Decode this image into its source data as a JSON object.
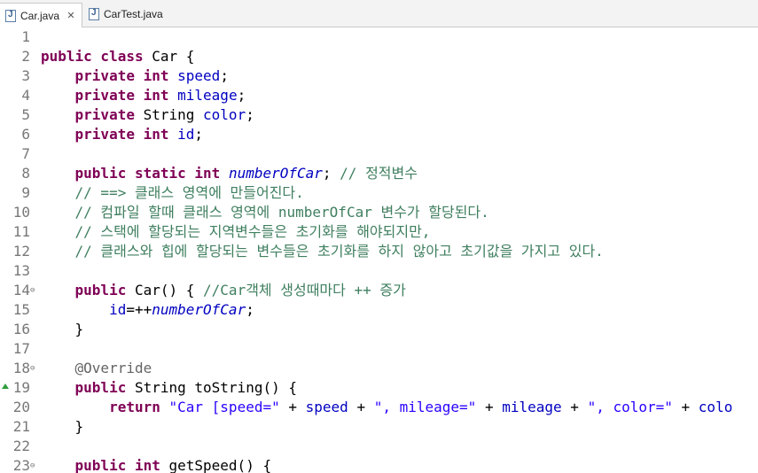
{
  "tabs": [
    {
      "label": "Car.java",
      "active": true
    },
    {
      "label": "CarTest.java",
      "active": false
    }
  ],
  "close_glyph": "✕",
  "lines": [
    {
      "n": "1",
      "tokens": []
    },
    {
      "n": "2",
      "tokens": [
        {
          "t": "public class",
          "c": "kw"
        },
        {
          "t": " Car {",
          "c": ""
        }
      ]
    },
    {
      "n": "3",
      "tokens": [
        {
          "t": "    ",
          "c": ""
        },
        {
          "t": "private int",
          "c": "kw"
        },
        {
          "t": " ",
          "c": ""
        },
        {
          "t": "speed",
          "c": "fld"
        },
        {
          "t": ";",
          "c": ""
        }
      ]
    },
    {
      "n": "4",
      "tokens": [
        {
          "t": "    ",
          "c": ""
        },
        {
          "t": "private int",
          "c": "kw"
        },
        {
          "t": " ",
          "c": ""
        },
        {
          "t": "mileage",
          "c": "fld"
        },
        {
          "t": ";",
          "c": ""
        }
      ]
    },
    {
      "n": "5",
      "tokens": [
        {
          "t": "    ",
          "c": ""
        },
        {
          "t": "private",
          "c": "kw"
        },
        {
          "t": " String ",
          "c": ""
        },
        {
          "t": "color",
          "c": "fld"
        },
        {
          "t": ";",
          "c": ""
        }
      ]
    },
    {
      "n": "6",
      "tokens": [
        {
          "t": "    ",
          "c": ""
        },
        {
          "t": "private int",
          "c": "kw"
        },
        {
          "t": " ",
          "c": ""
        },
        {
          "t": "id",
          "c": "fld"
        },
        {
          "t": ";",
          "c": ""
        }
      ]
    },
    {
      "n": "7",
      "tokens": []
    },
    {
      "n": "8",
      "tokens": [
        {
          "t": "    ",
          "c": ""
        },
        {
          "t": "public static int",
          "c": "kw"
        },
        {
          "t": " ",
          "c": ""
        },
        {
          "t": "numberOfCar",
          "c": "sfld"
        },
        {
          "t": "; ",
          "c": ""
        },
        {
          "t": "// 정적변수",
          "c": "cm"
        }
      ]
    },
    {
      "n": "9",
      "tokens": [
        {
          "t": "    ",
          "c": ""
        },
        {
          "t": "// ==> 클래스 영역에 만들어진다.",
          "c": "cm"
        }
      ]
    },
    {
      "n": "10",
      "tokens": [
        {
          "t": "    ",
          "c": ""
        },
        {
          "t": "// 컴파일 할때 클래스 영역에 numberOfCar 변수가 할당된다.",
          "c": "cm"
        }
      ]
    },
    {
      "n": "11",
      "tokens": [
        {
          "t": "    ",
          "c": ""
        },
        {
          "t": "// 스택에 할당되는 지역변수들은 초기화를 해야되지만,",
          "c": "cm"
        }
      ]
    },
    {
      "n": "12",
      "tokens": [
        {
          "t": "    ",
          "c": ""
        },
        {
          "t": "// 클래스와 힙에 할당되는 변수들은 초기화를 하지 않아고 초기값을 가지고 있다.",
          "c": "cm"
        }
      ]
    },
    {
      "n": "13",
      "tokens": []
    },
    {
      "n": "14",
      "fold": true,
      "tokens": [
        {
          "t": "    ",
          "c": ""
        },
        {
          "t": "public",
          "c": "kw"
        },
        {
          "t": " Car() { ",
          "c": ""
        },
        {
          "t": "//Car객체 생성때마다 ++ 증가",
          "c": "cm"
        }
      ]
    },
    {
      "n": "15",
      "tokens": [
        {
          "t": "        ",
          "c": ""
        },
        {
          "t": "id",
          "c": "fld"
        },
        {
          "t": "=++",
          "c": ""
        },
        {
          "t": "numberOfCar",
          "c": "sfld"
        },
        {
          "t": ";",
          "c": ""
        }
      ]
    },
    {
      "n": "16",
      "tokens": [
        {
          "t": "    }",
          "c": ""
        }
      ]
    },
    {
      "n": "17",
      "tokens": []
    },
    {
      "n": "18",
      "fold": true,
      "tokens": [
        {
          "t": "    ",
          "c": ""
        },
        {
          "t": "@Override",
          "c": "ann"
        }
      ]
    },
    {
      "n": "19",
      "override": true,
      "tokens": [
        {
          "t": "    ",
          "c": ""
        },
        {
          "t": "public",
          "c": "kw"
        },
        {
          "t": " String toString() {",
          "c": ""
        }
      ]
    },
    {
      "n": "20",
      "tokens": [
        {
          "t": "        ",
          "c": ""
        },
        {
          "t": "return",
          "c": "kw"
        },
        {
          "t": " ",
          "c": ""
        },
        {
          "t": "\"Car [speed=\"",
          "c": "str"
        },
        {
          "t": " + ",
          "c": ""
        },
        {
          "t": "speed",
          "c": "fld"
        },
        {
          "t": " + ",
          "c": ""
        },
        {
          "t": "\", mileage=\"",
          "c": "str"
        },
        {
          "t": " + ",
          "c": ""
        },
        {
          "t": "mileage",
          "c": "fld"
        },
        {
          "t": " + ",
          "c": ""
        },
        {
          "t": "\", color=\"",
          "c": "str"
        },
        {
          "t": " + ",
          "c": ""
        },
        {
          "t": "colo",
          "c": "fld"
        }
      ]
    },
    {
      "n": "21",
      "tokens": [
        {
          "t": "    }",
          "c": ""
        }
      ]
    },
    {
      "n": "22",
      "tokens": []
    },
    {
      "n": "23",
      "fold": true,
      "tokens": [
        {
          "t": "    ",
          "c": ""
        },
        {
          "t": "public int",
          "c": "kw"
        },
        {
          "t": " getSpeed() {",
          "c": ""
        }
      ]
    }
  ]
}
